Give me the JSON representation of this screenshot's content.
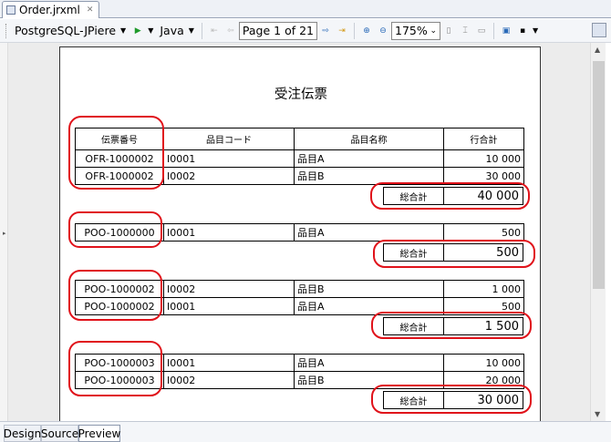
{
  "editor": {
    "tab_title": "Order.jrxml"
  },
  "toolbar": {
    "connection": "PostgreSQL-JPiere",
    "language": "Java",
    "page_indicator": "Page 1 of 21",
    "zoom": "175%"
  },
  "report": {
    "title": "受注伝票",
    "headers": [
      "伝票番号",
      "品目コード",
      "品目名称",
      "行合計"
    ],
    "total_label": "総合計",
    "groups": [
      {
        "rows": [
          [
            "OFR-1000002",
            "I0001",
            "品目A",
            "10 000"
          ],
          [
            "OFR-1000002",
            "I0002",
            "品目B",
            "30 000"
          ]
        ],
        "total": "40 000"
      },
      {
        "rows": [
          [
            "POO-1000000",
            "I0001",
            "品目A",
            "500"
          ]
        ],
        "total": "500"
      },
      {
        "rows": [
          [
            "POO-1000002",
            "I0002",
            "品目B",
            "1 000"
          ],
          [
            "POO-1000002",
            "I0001",
            "品目A",
            "500"
          ]
        ],
        "total": "1 500"
      },
      {
        "rows": [
          [
            "POO-1000003",
            "I0001",
            "品目A",
            "10 000"
          ],
          [
            "POO-1000003",
            "I0002",
            "品目B",
            "20 000"
          ]
        ],
        "total": "30 000"
      }
    ]
  },
  "bottom_tabs": [
    "Design",
    "Source",
    "Preview"
  ],
  "colors": {
    "highlight": "#e0121a",
    "page_border": "#333333",
    "workspace": "#ececec"
  }
}
